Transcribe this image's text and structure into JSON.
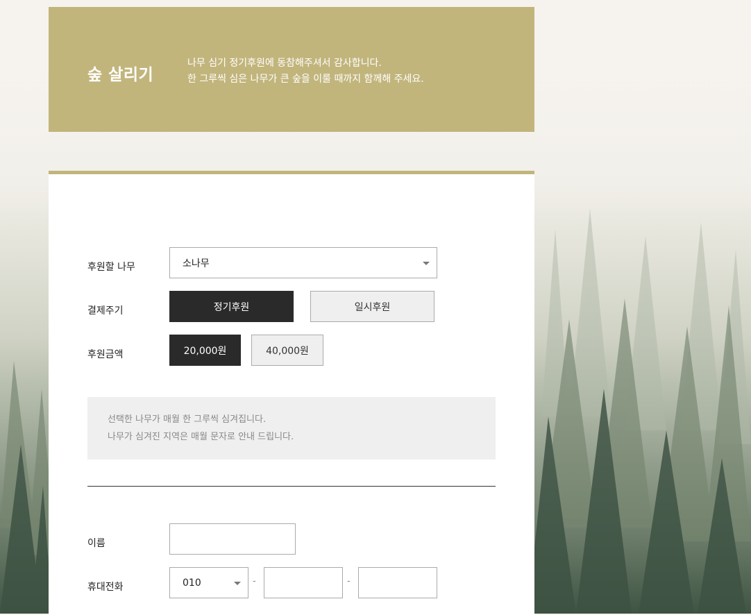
{
  "hero": {
    "title": "숲 살리기",
    "desc_line1": "나무 심기 정기후원에 동참해주셔서 감사합니다.",
    "desc_line2": "한 그루씩 심은 나무가 큰 숲을 이룰 때까지 함께해 주세요.",
    "bg_color": "#c2b57c"
  },
  "form": {
    "tree": {
      "label": "후원할 나무",
      "selected": "소나무"
    },
    "cycle": {
      "label": "결제주기",
      "options": [
        "정기후원",
        "일시후원"
      ],
      "selected_index": 0
    },
    "amount": {
      "label": "후원금액",
      "options": [
        "20,000원",
        "40,000원"
      ],
      "selected_index": 0
    },
    "notice": {
      "line1": "선택한 나무가 매월 한 그루씩 심겨집니다.",
      "line2": "나무가 심겨진 지역은 매월 문자로 안내 드립니다."
    },
    "name": {
      "label": "이름",
      "value": ""
    },
    "phone": {
      "label": "휴대전화",
      "prefix": "010",
      "middle": "",
      "last": "",
      "separator": "-"
    }
  },
  "colors": {
    "accent": "#c2b57c",
    "selected_button": "#2a2a2a",
    "notice_bg": "#efefef"
  }
}
